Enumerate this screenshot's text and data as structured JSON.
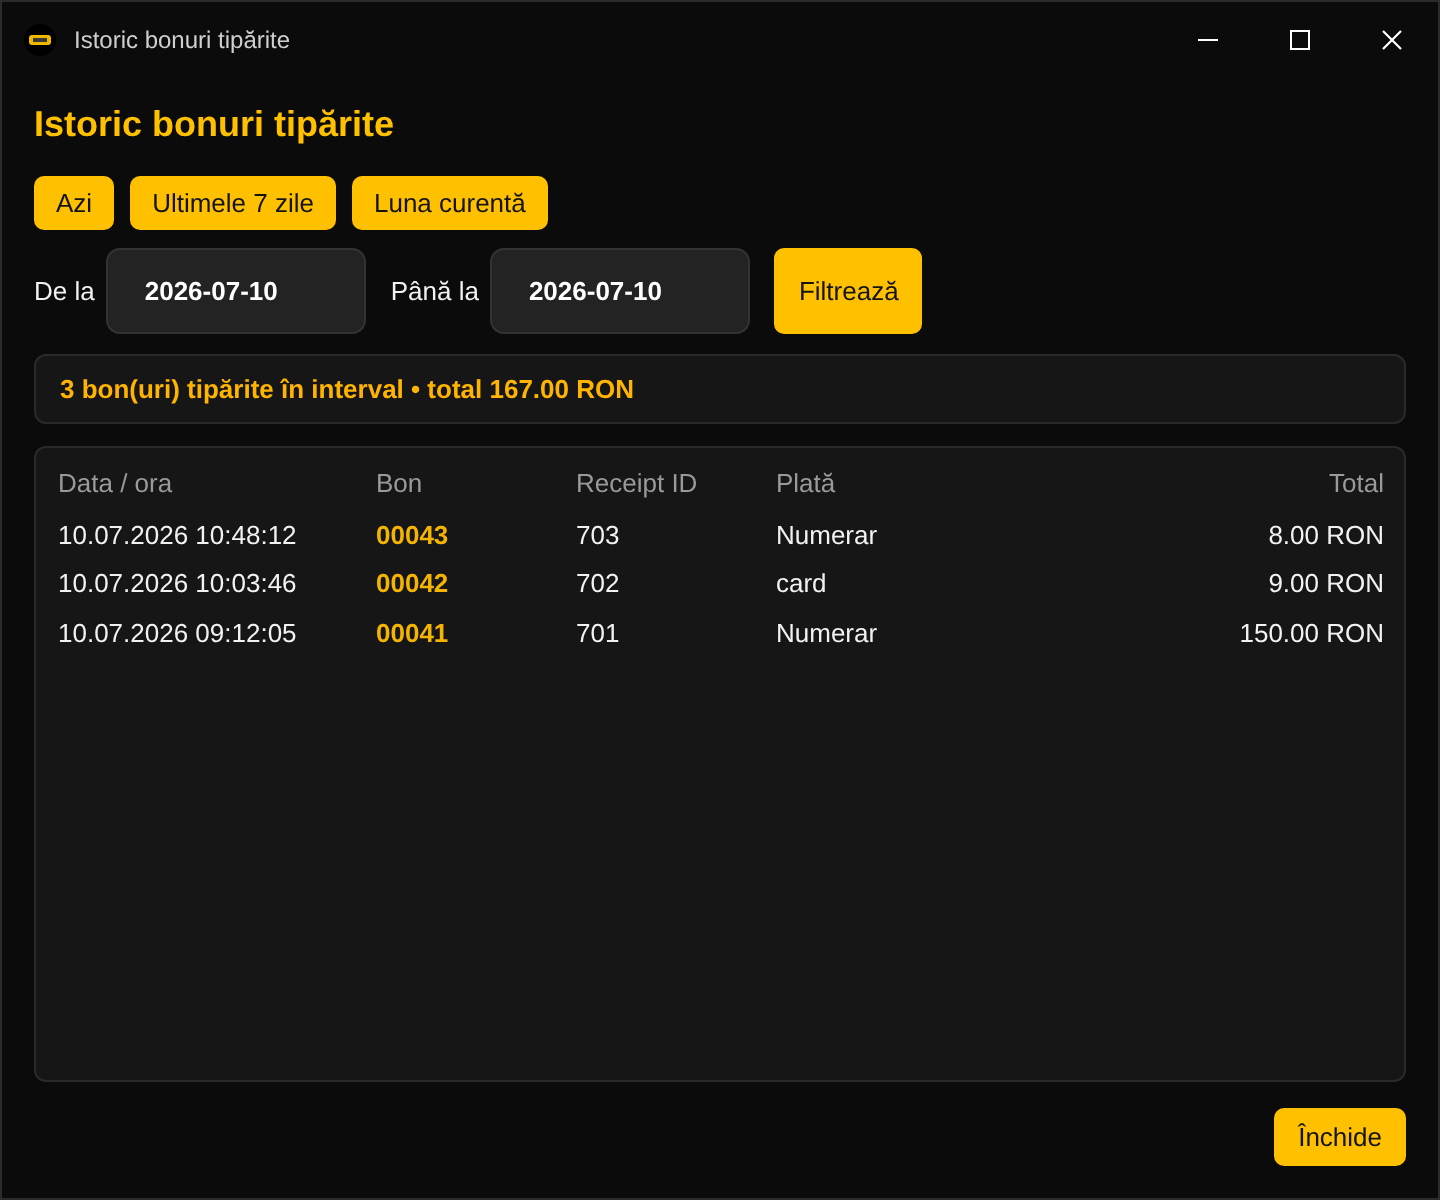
{
  "window": {
    "title": "Istoric bonuri tipărite"
  },
  "heading": "Istoric bonuri tipărite",
  "presets": [
    "Azi",
    "Ultimele 7 zile",
    "Luna curentă"
  ],
  "filter": {
    "from": {
      "label": "De la",
      "value": "2026-07-10"
    },
    "to": {
      "label": "Până la",
      "value": "2026-07-10"
    },
    "button": "Filtrează"
  },
  "summary": "3 bon(uri) tipărite în interval • total 167.00 RON",
  "table": {
    "columns": [
      {
        "label": "Data / ora",
        "kind": "text"
      },
      {
        "label": "Bon",
        "kind": "highlight"
      },
      {
        "label": "Receipt ID",
        "kind": "text"
      },
      {
        "label": "Plată",
        "kind": "text"
      },
      {
        "label": "Total",
        "kind": "amount"
      }
    ],
    "rows": [
      [
        "10.07.2026 10:48:12",
        "00043",
        "703",
        "Numerar",
        "8.00 RON"
      ],
      [
        "10.07.2026 10:03:46",
        "00042",
        "702",
        "card",
        "9.00 RON"
      ],
      [
        "10.07.2026 09:12:05",
        "00041",
        "701",
        "Numerar",
        "150.00 RON"
      ]
    ]
  },
  "footer": {
    "close_button": "Închide"
  }
}
